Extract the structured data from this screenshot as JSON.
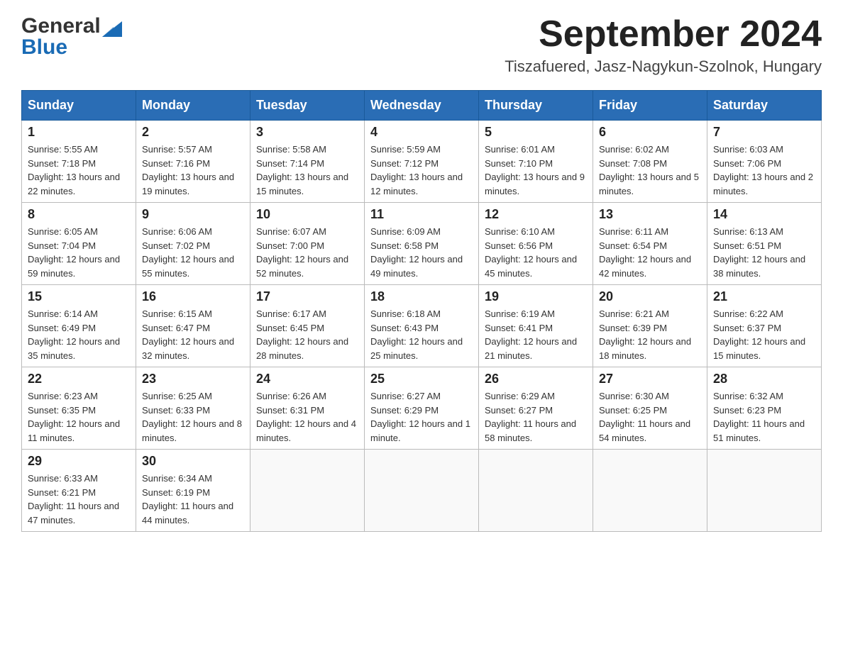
{
  "header": {
    "logo": {
      "text_general": "General",
      "text_blue": "Blue"
    },
    "title": "September 2024",
    "location": "Tiszafuered, Jasz-Nagykun-Szolnok, Hungary"
  },
  "calendar": {
    "headers": [
      "Sunday",
      "Monday",
      "Tuesday",
      "Wednesday",
      "Thursday",
      "Friday",
      "Saturday"
    ],
    "weeks": [
      [
        {
          "day": "1",
          "sunrise": "5:55 AM",
          "sunset": "7:18 PM",
          "daylight": "13 hours and 22 minutes."
        },
        {
          "day": "2",
          "sunrise": "5:57 AM",
          "sunset": "7:16 PM",
          "daylight": "13 hours and 19 minutes."
        },
        {
          "day": "3",
          "sunrise": "5:58 AM",
          "sunset": "7:14 PM",
          "daylight": "13 hours and 15 minutes."
        },
        {
          "day": "4",
          "sunrise": "5:59 AM",
          "sunset": "7:12 PM",
          "daylight": "13 hours and 12 minutes."
        },
        {
          "day": "5",
          "sunrise": "6:01 AM",
          "sunset": "7:10 PM",
          "daylight": "13 hours and 9 minutes."
        },
        {
          "day": "6",
          "sunrise": "6:02 AM",
          "sunset": "7:08 PM",
          "daylight": "13 hours and 5 minutes."
        },
        {
          "day": "7",
          "sunrise": "6:03 AM",
          "sunset": "7:06 PM",
          "daylight": "13 hours and 2 minutes."
        }
      ],
      [
        {
          "day": "8",
          "sunrise": "6:05 AM",
          "sunset": "7:04 PM",
          "daylight": "12 hours and 59 minutes."
        },
        {
          "day": "9",
          "sunrise": "6:06 AM",
          "sunset": "7:02 PM",
          "daylight": "12 hours and 55 minutes."
        },
        {
          "day": "10",
          "sunrise": "6:07 AM",
          "sunset": "7:00 PM",
          "daylight": "12 hours and 52 minutes."
        },
        {
          "day": "11",
          "sunrise": "6:09 AM",
          "sunset": "6:58 PM",
          "daylight": "12 hours and 49 minutes."
        },
        {
          "day": "12",
          "sunrise": "6:10 AM",
          "sunset": "6:56 PM",
          "daylight": "12 hours and 45 minutes."
        },
        {
          "day": "13",
          "sunrise": "6:11 AM",
          "sunset": "6:54 PM",
          "daylight": "12 hours and 42 minutes."
        },
        {
          "day": "14",
          "sunrise": "6:13 AM",
          "sunset": "6:51 PM",
          "daylight": "12 hours and 38 minutes."
        }
      ],
      [
        {
          "day": "15",
          "sunrise": "6:14 AM",
          "sunset": "6:49 PM",
          "daylight": "12 hours and 35 minutes."
        },
        {
          "day": "16",
          "sunrise": "6:15 AM",
          "sunset": "6:47 PM",
          "daylight": "12 hours and 32 minutes."
        },
        {
          "day": "17",
          "sunrise": "6:17 AM",
          "sunset": "6:45 PM",
          "daylight": "12 hours and 28 minutes."
        },
        {
          "day": "18",
          "sunrise": "6:18 AM",
          "sunset": "6:43 PM",
          "daylight": "12 hours and 25 minutes."
        },
        {
          "day": "19",
          "sunrise": "6:19 AM",
          "sunset": "6:41 PM",
          "daylight": "12 hours and 21 minutes."
        },
        {
          "day": "20",
          "sunrise": "6:21 AM",
          "sunset": "6:39 PM",
          "daylight": "12 hours and 18 minutes."
        },
        {
          "day": "21",
          "sunrise": "6:22 AM",
          "sunset": "6:37 PM",
          "daylight": "12 hours and 15 minutes."
        }
      ],
      [
        {
          "day": "22",
          "sunrise": "6:23 AM",
          "sunset": "6:35 PM",
          "daylight": "12 hours and 11 minutes."
        },
        {
          "day": "23",
          "sunrise": "6:25 AM",
          "sunset": "6:33 PM",
          "daylight": "12 hours and 8 minutes."
        },
        {
          "day": "24",
          "sunrise": "6:26 AM",
          "sunset": "6:31 PM",
          "daylight": "12 hours and 4 minutes."
        },
        {
          "day": "25",
          "sunrise": "6:27 AM",
          "sunset": "6:29 PM",
          "daylight": "12 hours and 1 minute."
        },
        {
          "day": "26",
          "sunrise": "6:29 AM",
          "sunset": "6:27 PM",
          "daylight": "11 hours and 58 minutes."
        },
        {
          "day": "27",
          "sunrise": "6:30 AM",
          "sunset": "6:25 PM",
          "daylight": "11 hours and 54 minutes."
        },
        {
          "day": "28",
          "sunrise": "6:32 AM",
          "sunset": "6:23 PM",
          "daylight": "11 hours and 51 minutes."
        }
      ],
      [
        {
          "day": "29",
          "sunrise": "6:33 AM",
          "sunset": "6:21 PM",
          "daylight": "11 hours and 47 minutes."
        },
        {
          "day": "30",
          "sunrise": "6:34 AM",
          "sunset": "6:19 PM",
          "daylight": "11 hours and 44 minutes."
        },
        null,
        null,
        null,
        null,
        null
      ]
    ]
  }
}
